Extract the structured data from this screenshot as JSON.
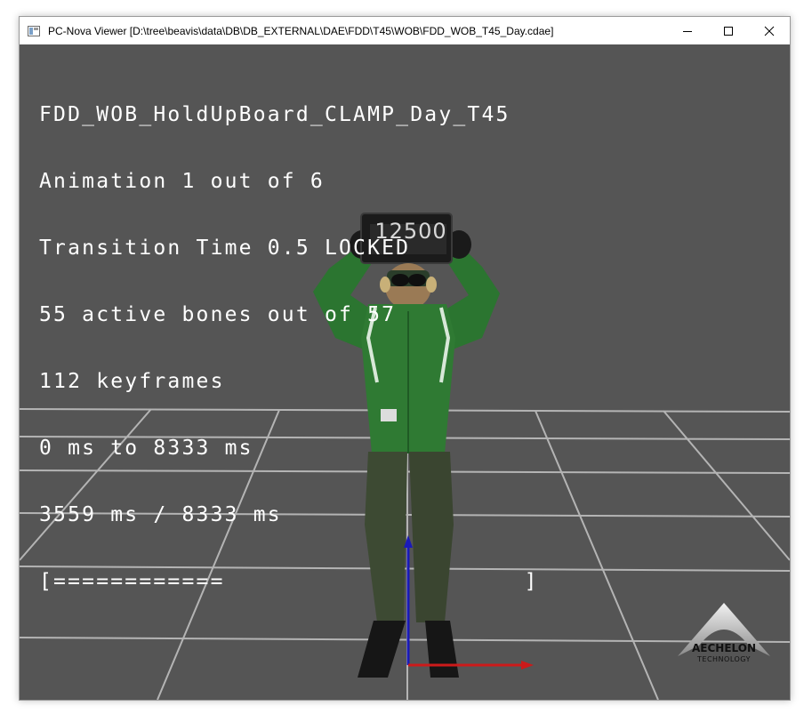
{
  "window": {
    "title": "PC-Nova Viewer [D:\\tree\\beavis\\data\\DB\\DB_EXTERNAL\\DAE\\FDD\\T45\\WOB\\FDD_WOB_T45_Day.cdae]",
    "controls": {
      "minimize": "minimize-icon",
      "maximize": "maximize-icon",
      "close": "close-icon"
    }
  },
  "hud": {
    "animation_name": "FDD_WOB_HoldUpBoard_CLAMP_Day_T45",
    "animation_index": "Animation 1 out of 6",
    "transition": "Transition Time 0.5 LOCKED",
    "bones": "55 active bones out of 57",
    "keyframes": "112 keyframes",
    "range": "0 ms to 8333 ms",
    "time": "3559 ms / 8333 ms",
    "progress_bar": "[============                     ]",
    "progress_fraction": 0.427
  },
  "scene": {
    "board_number": "12500",
    "background_color": "#555555",
    "grid_color": "#b4b4b4",
    "vest_color": "#2f7a33",
    "axis_colors": {
      "y": "#1a1ab8",
      "x": "#cc1a1a"
    }
  },
  "logo": {
    "name": "AECHELON",
    "subtitle": "TECHNOLOGY"
  }
}
